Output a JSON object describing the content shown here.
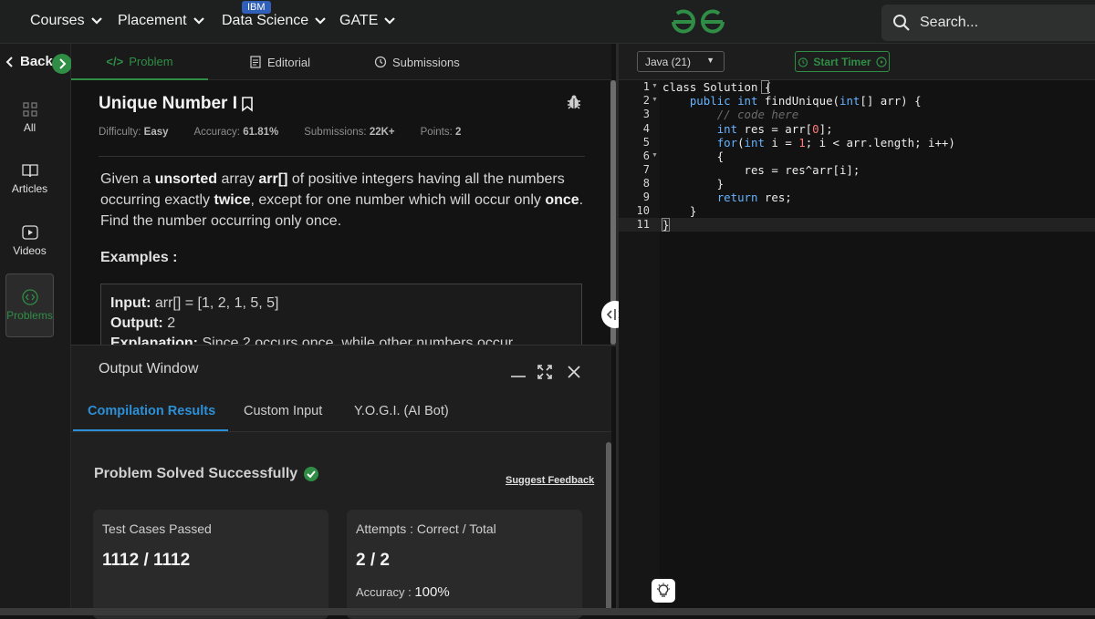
{
  "nav": {
    "items": [
      {
        "label": "Courses"
      },
      {
        "label": "Placement"
      },
      {
        "label": "Data Science"
      },
      {
        "label": "GATE"
      }
    ],
    "badge": "IBM",
    "search_placeholder": "Search..."
  },
  "rail": {
    "back_label": "Back",
    "items": [
      {
        "label": "All",
        "icon": "grid-icon"
      },
      {
        "label": "Articles",
        "icon": "book-icon"
      },
      {
        "label": "Videos",
        "icon": "play-icon"
      },
      {
        "label": "Problems",
        "icon": "code-icon"
      }
    ]
  },
  "problem_tabs": {
    "problem": "Problem",
    "editorial": "Editorial",
    "submissions": "Submissions"
  },
  "problem": {
    "title": "Unique Number I",
    "difficulty_label": "Difficulty:",
    "difficulty": "Easy",
    "accuracy_label": "Accuracy:",
    "accuracy": "61.81%",
    "submissions_label": "Submissions:",
    "submissions": "22K+",
    "points_label": "Points:",
    "points": "2",
    "desc_1": "Given a ",
    "desc_2": "unsorted",
    "desc_3": " array ",
    "desc_4": "arr[]",
    "desc_5": " of positive integers having all the numbers occurring exactly ",
    "desc_6": "twice",
    "desc_7": ", except for one number which will occur only ",
    "desc_8": "once",
    "desc_9": ". Find the number occurring only once.",
    "examples_heading": "Examples :",
    "ex_input_label": "Input:",
    "ex_input": " arr[] = [1, 2, 1, 5, 5]",
    "ex_output_label": "Output:",
    "ex_output": " 2",
    "ex_expl_label": "Explanation:",
    "ex_expl": " Since 2 occurs once, while other numbers occur"
  },
  "output": {
    "title": "Output Window",
    "tabs": [
      "Compilation Results",
      "Custom Input",
      "Y.O.G.I. (AI Bot)"
    ],
    "solved_text": "Problem Solved Successfully",
    "feedback": "Suggest Feedback",
    "test_cases_label": "Test Cases Passed",
    "test_cases_value": "1112 / 1112",
    "attempts_label": "Attempts : Correct / Total",
    "attempts_value": "2 / 2",
    "accuracy_label": "Accuracy :",
    "accuracy_value": "100%"
  },
  "editor": {
    "language": "Java (21)",
    "timer_label": "Start Timer",
    "line_numbers": [
      "1",
      "2",
      "3",
      "4",
      "5",
      "6",
      "7",
      "8",
      "9",
      "10",
      "11"
    ]
  },
  "colors": {
    "accent_green": "#2f8d46",
    "accent_blue": "#2d8fd6",
    "keyword_blue": "#66b3ff"
  }
}
